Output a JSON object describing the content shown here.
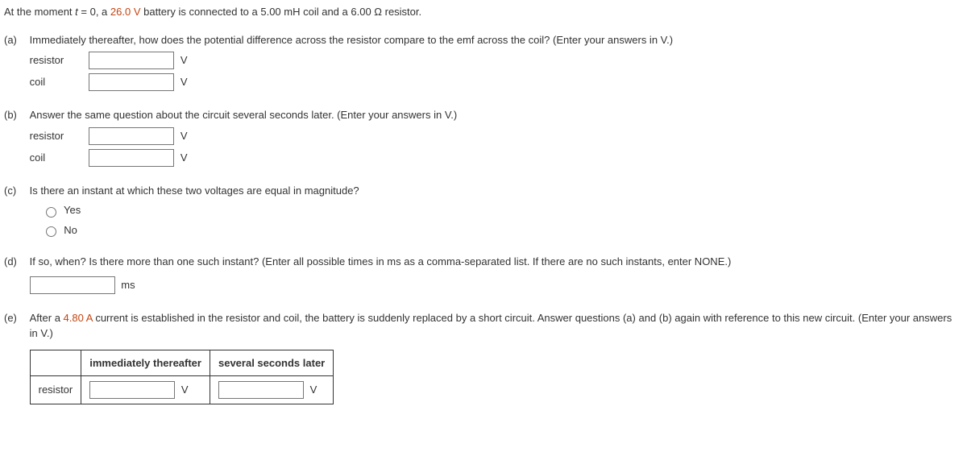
{
  "intro": {
    "prefix": "At the moment ",
    "t_var": "t",
    "equals": " = 0, a ",
    "voltage": "26.0 V",
    "mid1": " battery is connected to a 5.00 mH coil and a 6.00 Ω resistor."
  },
  "parts": {
    "a": {
      "label": "(a)",
      "question": "Immediately thereafter, how does the potential difference across the resistor compare to the emf across the coil? (Enter your answers in V.)",
      "row1_label": "resistor",
      "row1_unit": "V",
      "row2_label": "coil",
      "row2_unit": "V"
    },
    "b": {
      "label": "(b)",
      "question": "Answer the same question about the circuit several seconds later. (Enter your answers in V.)",
      "row1_label": "resistor",
      "row1_unit": "V",
      "row2_label": "coil",
      "row2_unit": "V"
    },
    "c": {
      "label": "(c)",
      "question": "Is there an instant at which these two voltages are equal in magnitude?",
      "opt_yes": "Yes",
      "opt_no": "No"
    },
    "d": {
      "label": "(d)",
      "question": "If so, when? Is there more than one such instant? (Enter all possible times in ms as a comma-separated list. If there are no such instants, enter NONE.)",
      "unit": "ms"
    },
    "e": {
      "label": "(e)",
      "q_prefix": "After a ",
      "current": "4.80 A",
      "q_suffix": " current is established in the resistor and coil, the battery is suddenly replaced by a short circuit. Answer questions (a) and (b) again with reference to this new circuit. (Enter your answers in V.)",
      "table": {
        "col1": "immediately thereafter",
        "col2": "several seconds later",
        "row1_label": "resistor",
        "unit": "V"
      }
    }
  }
}
